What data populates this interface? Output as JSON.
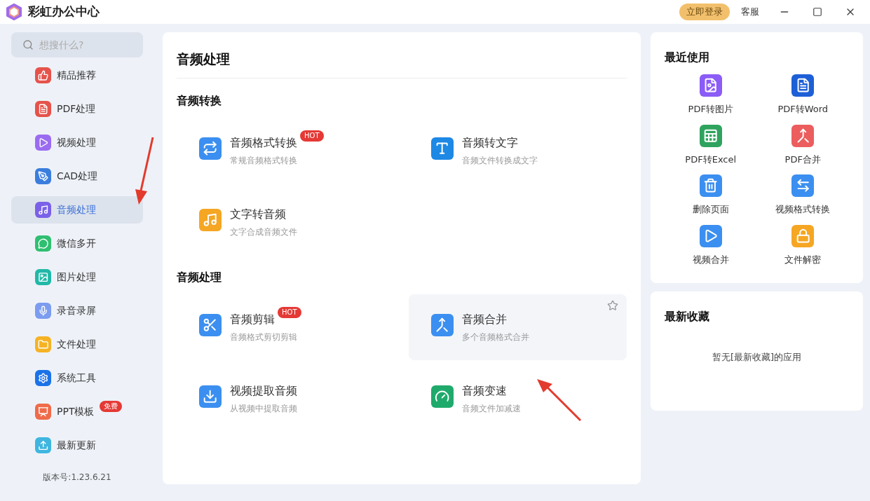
{
  "app": {
    "title": "彩虹办公中心",
    "login": "立即登录",
    "service": "客服"
  },
  "sidebar": {
    "search_placeholder": "想搜什么?",
    "items": [
      {
        "label": "精品推荐",
        "selected": false
      },
      {
        "label": "PDF处理",
        "selected": false
      },
      {
        "label": "视频处理",
        "selected": false
      },
      {
        "label": "CAD处理",
        "selected": false
      },
      {
        "label": "音频处理",
        "selected": true
      },
      {
        "label": "微信多开",
        "selected": false
      },
      {
        "label": "图片处理",
        "selected": false
      },
      {
        "label": "录音录屏",
        "selected": false
      },
      {
        "label": "文件处理",
        "selected": false
      },
      {
        "label": "系统工具",
        "selected": false
      },
      {
        "label": "PPT模板",
        "selected": false,
        "badge": "免费"
      },
      {
        "label": "最新更新",
        "selected": false
      }
    ],
    "version": "版本号:1.23.6.21"
  },
  "main": {
    "title": "音频处理",
    "sections": [
      {
        "title": "音频转换",
        "tools": [
          {
            "name": "音频格式转换",
            "desc": "常规音频格式转换",
            "badge": "HOT",
            "highlighted": false
          },
          {
            "name": "音频转文字",
            "desc": "音频文件转换成文字",
            "highlighted": false
          },
          {
            "name": "文字转音频",
            "desc": "文字合成音频文件",
            "highlighted": false
          }
        ]
      },
      {
        "title": "音频处理",
        "tools": [
          {
            "name": "音频剪辑",
            "desc": "音频格式剪切剪辑",
            "badge": "HOT",
            "highlighted": false
          },
          {
            "name": "音频合并",
            "desc": "多个音频格式合并",
            "highlighted": true
          },
          {
            "name": "视频提取音频",
            "desc": "从视频中提取音频",
            "highlighted": false
          },
          {
            "name": "音频变速",
            "desc": "音频文件加减速",
            "highlighted": false
          }
        ]
      }
    ]
  },
  "recent": {
    "title": "最近使用",
    "items": [
      "PDF转图片",
      "PDF转Word",
      "PDF转Excel",
      "PDF合并",
      "删除页面",
      "视频格式转换",
      "视频合并",
      "文件解密"
    ]
  },
  "favorites": {
    "title": "最新收藏",
    "empty": "暂无[最新收藏]的应用"
  }
}
